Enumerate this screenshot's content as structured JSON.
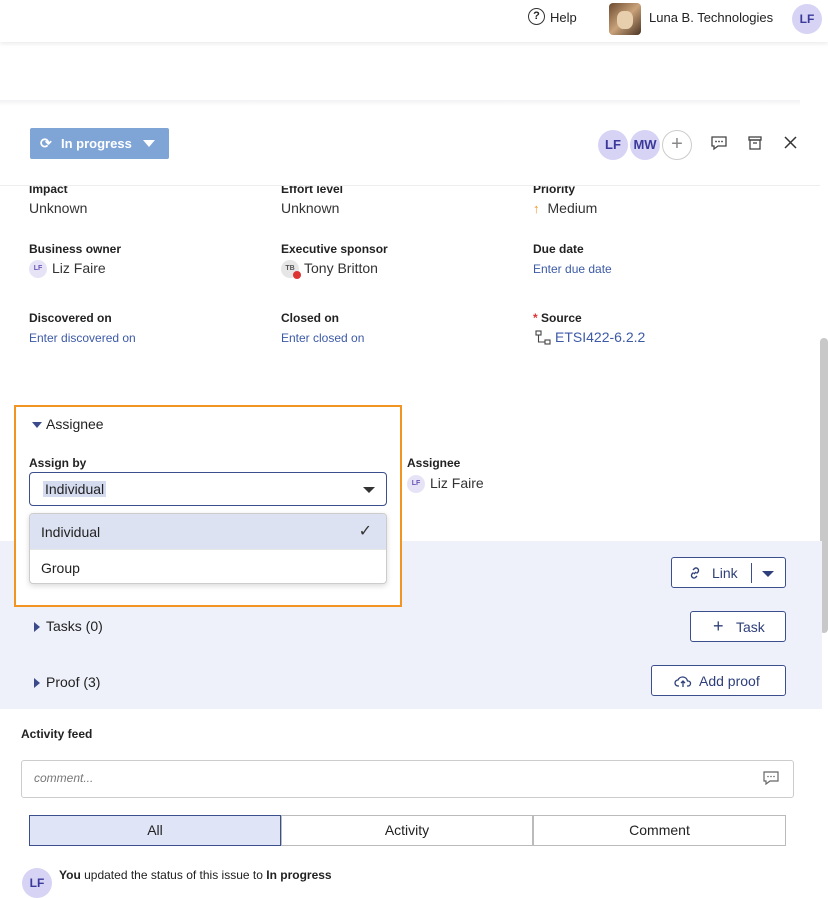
{
  "topbar": {
    "help_icon": "question-circle-icon",
    "help_label": "Help",
    "org_name": "Luna B. Technologies",
    "user_initials": "LF"
  },
  "header": {
    "status_label": "In progress",
    "assignee_avatars": [
      "LF",
      "MW"
    ],
    "icons": [
      "sync-icon",
      "caret-down-icon",
      "add-person-icon",
      "comment-icon",
      "archive-icon",
      "close-icon"
    ]
  },
  "fields": {
    "impact_label": "Impact",
    "impact_value": "Unknown",
    "effort_label": "Effort level",
    "effort_value": "Unknown",
    "priority_label": "Priority",
    "priority_value": "Medium",
    "business_owner_label": "Business owner",
    "business_owner_value": "Liz Faire",
    "executive_sponsor_label": "Executive sponsor",
    "executive_sponsor_value": "Tony Britton",
    "due_date_label": "Due date",
    "due_date_placeholder": "Enter due date",
    "discovered_label": "Discovered on",
    "discovered_placeholder": "Enter discovered on",
    "closed_label": "Closed on",
    "closed_placeholder": "Enter closed on",
    "source_required_mark": "*",
    "source_label": "Source",
    "source_value": "ETSI422-6.2.2"
  },
  "assignee_section": {
    "title": "Assignee",
    "assign_by_label": "Assign by",
    "assign_by_value": "Individual",
    "options": [
      "Individual",
      "Group"
    ],
    "selected_option": "Individual",
    "assignee_label": "Assignee",
    "assignee_value": "Liz Faire"
  },
  "links_section": {
    "link_button": "Link",
    "tasks_label": "Tasks (0)",
    "task_button": "Task",
    "proof_label": "Proof (3)",
    "add_proof_button": "Add proof"
  },
  "activity": {
    "title": "Activity feed",
    "comment_placeholder": "comment...",
    "tabs": [
      "All",
      "Activity",
      "Comment"
    ],
    "active_tab": "All",
    "feed_item": {
      "avatar": "LF",
      "actor": "You",
      "text": " updated the status of this issue to ",
      "status": "In progress"
    }
  },
  "colors": {
    "accent": "#3b4f8c",
    "status_button": "#7fa4d6",
    "highlight_box": "#f29421",
    "priority_arrow": "#f29421",
    "section_bg": "#eef1fa"
  }
}
